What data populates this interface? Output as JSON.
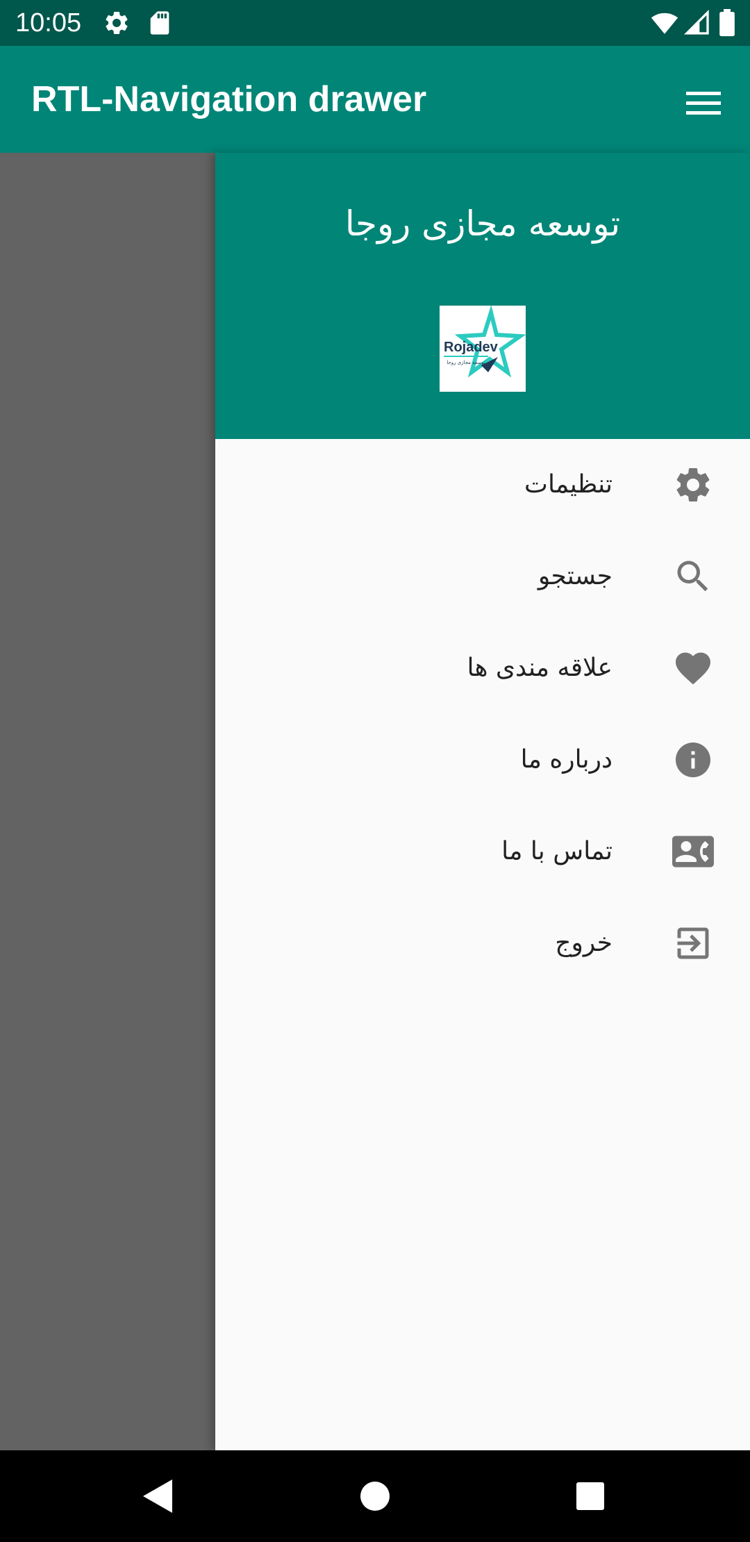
{
  "status_bar": {
    "time": "10:05",
    "icons": [
      "settings-icon",
      "sd-card-icon",
      "wifi-icon",
      "signal-icon",
      "battery-icon"
    ]
  },
  "toolbar": {
    "title": "RTL-Navigation drawer",
    "menu_icon": "hamburger-menu-icon"
  },
  "drawer": {
    "header_title": "توسعه مجازی روجا",
    "logo_text": "Rojadev",
    "logo_subtext": "توسعه مجازی روجا",
    "items": [
      {
        "label": "تنظیمات",
        "icon": "gear-icon"
      },
      {
        "label": "جستجو",
        "icon": "search-icon"
      },
      {
        "label": "علاقه مندی ها",
        "icon": "heart-icon"
      },
      {
        "label": "درباره ما",
        "icon": "info-icon"
      },
      {
        "label": "تماس با ما",
        "icon": "contact-phone-icon"
      },
      {
        "label": "خروج",
        "icon": "exit-icon"
      }
    ]
  },
  "nav_bar": {
    "buttons": [
      "back-icon",
      "home-icon",
      "recents-icon"
    ]
  },
  "colors": {
    "primary": "#008577",
    "primary_dark": "#00574b",
    "accent": "#2ccbc0",
    "icon_gray": "#757575",
    "scrim": "#636363"
  }
}
